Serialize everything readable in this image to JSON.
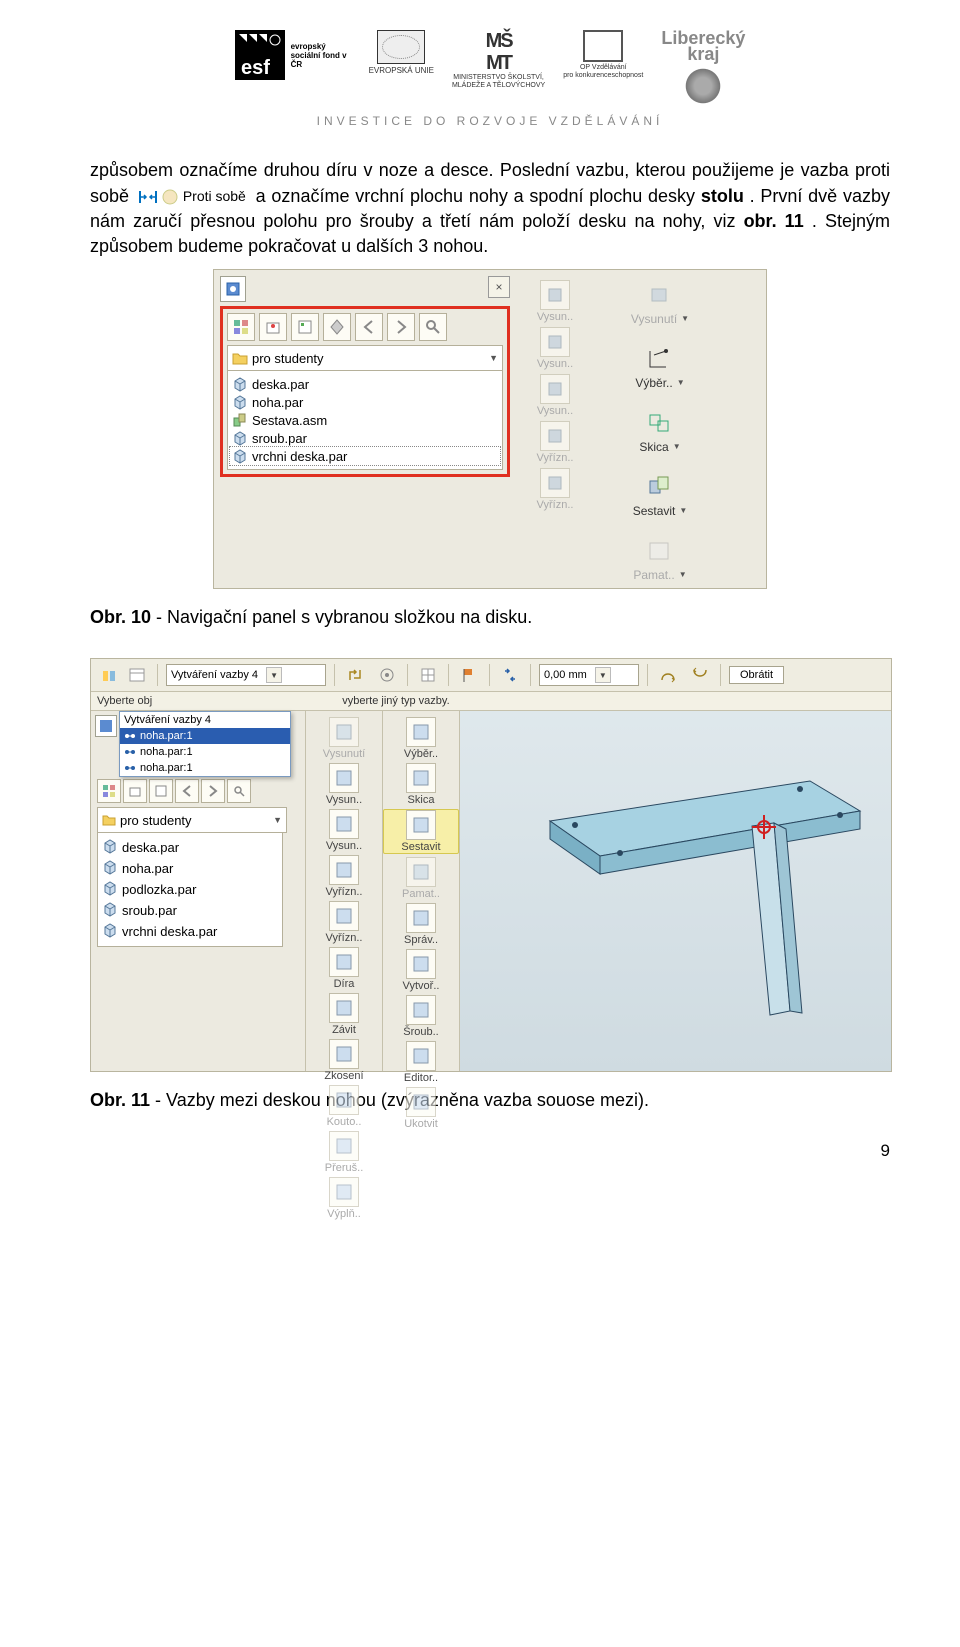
{
  "header": {
    "esf_text": "evropský sociální fond v ČR",
    "eu_label": "EVROPSKÁ UNIE",
    "msmt_line1": "MINISTERSTVO ŠKOLSTVÍ,",
    "msmt_line2": "MLÁDEŽE A TĚLOVÝCHOVY",
    "op_line1": "OP Vzdělávání",
    "op_line2": "pro konkurenceschopnost",
    "kraj_top": "Liberecký",
    "kraj_bottom": "kraj",
    "tagline": "INVESTICE DO ROZVOJE VZDĚLÁVÁNÍ"
  },
  "paragraph": {
    "p1": "způsobem označíme druhou díru v noze a desce. Poslední vazbu, kterou použijeme je vazba proti sobě ",
    "inline_label": "Proti sobě",
    "p2": " a označíme vrchní plochu nohy a spodní plochu desky ",
    "p3_bold": "stolu",
    "p4": ". První dvě vazby nám zaručí přesnou polohu pro šrouby a třetí nám položí desku na nohy, viz ",
    "p5_bold": "obr. 11",
    "p6": ". Stejným způsobem budeme pokračovat u dalších 3 nohou."
  },
  "fig10": {
    "folder": "pro studenty",
    "files": [
      "deska.par",
      "noha.par",
      "Sestava.asm",
      "sroub.par",
      "vrchni deska.par"
    ],
    "mid_buttons": [
      "Vysun..",
      "Vysun..",
      "Vysun..",
      "Vyřízn..",
      "Vyřízn.."
    ],
    "right_buttons": [
      {
        "label": "Vysunutí",
        "dis": true
      },
      {
        "label": "Výběr..",
        "dis": false
      },
      {
        "label": "Skica",
        "dis": false
      },
      {
        "label": "Sestavit",
        "dis": false
      },
      {
        "label": "Pamat..",
        "dis": true
      }
    ]
  },
  "caption10": {
    "b": "Obr. 10",
    "rest": " - Navigační panel s vybranou složkou na disku."
  },
  "fig11": {
    "combo_title": "Vytváření vazby 4",
    "topbar_val": "0,00 mm",
    "btn_obratit": "Obrátit",
    "hint_left": "Vyberte obj",
    "hint_right": "vyberte jiný typ vazby.",
    "dd_label": "Vytváření vazby 4",
    "dd_items": [
      "noha.par:1",
      "noha.par:1",
      "noha.par:1"
    ],
    "folder": "pro studenty",
    "files": [
      "deska.par",
      "noha.par",
      "podlozka.par",
      "sroub.par",
      "vrchni deska.par"
    ],
    "midL": [
      "Vysunutí",
      "Vysun..",
      "Vysun..",
      "Vyřízn..",
      "Vyřízn..",
      "Díra",
      "Závit",
      "Zkosení",
      "Kouto..",
      "Přeruš..",
      "Výplň.."
    ],
    "midR": [
      "Výběr..",
      "Skica",
      "Sestavit",
      "Pamat..",
      "Správ..",
      "Vytvoř..",
      "Šroub..",
      "Editor..",
      "Ukotvit"
    ]
  },
  "caption11": {
    "b": "Obr. 11",
    "rest": " - Vazby mezi deskou nohou (zvýrazněna vazba souose mezi)."
  },
  "pagenum": "9",
  "chart_data": {
    "type": "table",
    "note": "no numeric chart present"
  }
}
